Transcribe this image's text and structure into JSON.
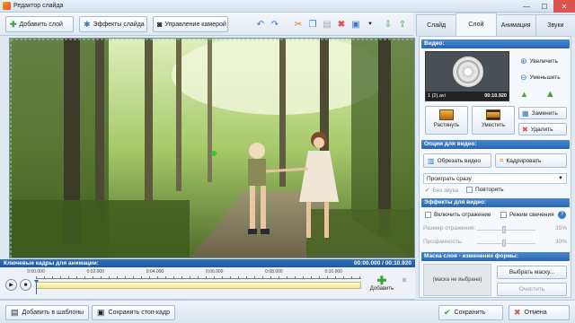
{
  "window": {
    "title": "Редактор слайда",
    "minimize": "—",
    "maximize": "☐",
    "close": "✕"
  },
  "toolbar": {
    "add_layer": "Добавить слой",
    "slide_effects": "Эффекты слайда",
    "camera_control": "Управление камерой"
  },
  "tabs": [
    "Слайд",
    "Слой",
    "Анимация",
    "Звуки"
  ],
  "keyframes": {
    "label": "Ключевые кадры для анимации:",
    "time": "00:00.000 / 00:10.920",
    "ticks": [
      "0:00.000",
      "0:02.000",
      "0:04.000",
      "0:06.000",
      "0:08.000",
      "0:10.000"
    ],
    "add_label": "Добавить"
  },
  "bottom": {
    "add_to_templates": "Добавить в шаблоны",
    "save_still": "Сохранить стоп-кадр",
    "save": "Сохранить",
    "cancel": "Отмена"
  },
  "video_section": {
    "title": "Видео:",
    "file": "1 (2).avi",
    "duration": "00:10.920",
    "zoom_in": "Увеличить",
    "zoom_out": "Уменьшить",
    "stretch": "Растянуть",
    "fit": "Уместить",
    "replace": "Заменить",
    "delete": "Удалить"
  },
  "video_options": {
    "title": "Опции для видео:",
    "trim": "Обрезать видео",
    "crop": "Кадрировать",
    "play_mode": "Проиграть сразу",
    "mute": "Без звука",
    "repeat": "Повторять"
  },
  "video_effects": {
    "title": "Эффекты для видео:",
    "reflection": "Включить отражение",
    "glow": "Режим свечения",
    "reflection_size_label": "Размер отражения:",
    "reflection_size": "35%",
    "transparency_label": "Прозрачность:",
    "transparency": "30%"
  },
  "mask": {
    "title": "Маска слоя - изменение формы:",
    "none": "(маска не выбрана)",
    "choose": "Выбрать маску...",
    "clear": "Очистить"
  },
  "colors": {
    "accent": "#2a66b3",
    "close": "#d9534f",
    "add_green": "#3aa23a"
  }
}
